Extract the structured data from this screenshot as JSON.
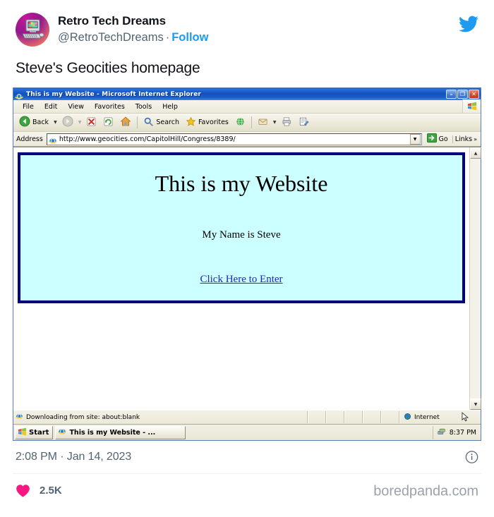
{
  "tweet": {
    "display_name": "Retro Tech Dreams",
    "handle": "@RetroTechDreams",
    "separator": "·",
    "follow_label": "Follow",
    "body_text": "Steve's Geocities homepage",
    "timestamp": "2:08 PM · Jan 14, 2023",
    "like_count": "2.5K",
    "watermark": "boredpanda.com",
    "accent_color": "#1d9bf0",
    "like_color": "#f91880",
    "avatar_icon": "retro-computer-icon",
    "logo_icon": "twitter-bird-icon",
    "info_icon": "info-circle-icon",
    "heart_icon": "heart-icon"
  },
  "browser": {
    "title": "This is my Website - Microsoft Internet Explorer",
    "title_icon": "internet-explorer-icon",
    "window_controls": [
      {
        "name": "minimize",
        "glyph": "–"
      },
      {
        "name": "restore",
        "glyph": "❐"
      },
      {
        "name": "close",
        "glyph": "✕"
      }
    ],
    "menus": [
      "File",
      "Edit",
      "View",
      "Favorites",
      "Tools",
      "Help"
    ],
    "menu_logo_icon": "windows-flag-icon",
    "toolbar": {
      "back_label": "Back",
      "search_label": "Search",
      "favorites_label": "Favorites",
      "buttons": [
        {
          "name": "back-button",
          "icon": "back-arrow-icon",
          "label": "Back"
        },
        {
          "name": "back-dropdown",
          "icon": "chevron-down-icon",
          "label": ""
        },
        {
          "name": "forward-button",
          "icon": "forward-arrow-icon",
          "label": ""
        },
        {
          "name": "forward-dropdown",
          "icon": "chevron-down-icon",
          "label": ""
        },
        {
          "name": "stop-button",
          "icon": "stop-icon",
          "label": ""
        },
        {
          "name": "refresh-button",
          "icon": "refresh-icon",
          "label": ""
        },
        {
          "name": "home-button",
          "icon": "home-icon",
          "label": ""
        },
        {
          "name": "search-button",
          "icon": "search-icon",
          "label": "Search"
        },
        {
          "name": "favorites-button",
          "icon": "star-icon",
          "label": "Favorites"
        },
        {
          "name": "media-button",
          "icon": "media-globe-icon",
          "label": ""
        },
        {
          "name": "mail-button",
          "icon": "mail-icon",
          "label": ""
        },
        {
          "name": "print-button",
          "icon": "print-icon",
          "label": ""
        },
        {
          "name": "edit-button",
          "icon": "edit-page-icon",
          "label": ""
        }
      ]
    },
    "address_bar": {
      "label": "Address",
      "url": "http://www.geocities.com/CapitolHill/Congress/8389/",
      "placeholder": "http://",
      "favicon": "internet-explorer-icon",
      "dropdown_glyph": "▼",
      "go_label": "Go",
      "links_label": "Links",
      "links_chevron": "»"
    },
    "page": {
      "heading": "This is my Website",
      "subheading": "My Name is Steve",
      "link_text": "Click Here to Enter",
      "background_color": "#ccffff",
      "border_color": "#000080",
      "link_color": "#2222cc"
    },
    "scrollbar": {
      "up_glyph": "▲",
      "down_glyph": "▼"
    },
    "status_bar": {
      "message": "Downloading from site: about:blank",
      "message_icon": "internet-explorer-icon",
      "zone_label": "Internet",
      "zone_icon": "globe-icon",
      "cursor_icon": "mouse-pointer-icon"
    },
    "taskbar": {
      "start_label": "Start",
      "start_icon": "windows-flag-icon",
      "task_label": "This is my Website - ...",
      "task_icon": "internet-explorer-icon",
      "tray_icon": "network-icon",
      "clock": "8:37 PM"
    }
  }
}
